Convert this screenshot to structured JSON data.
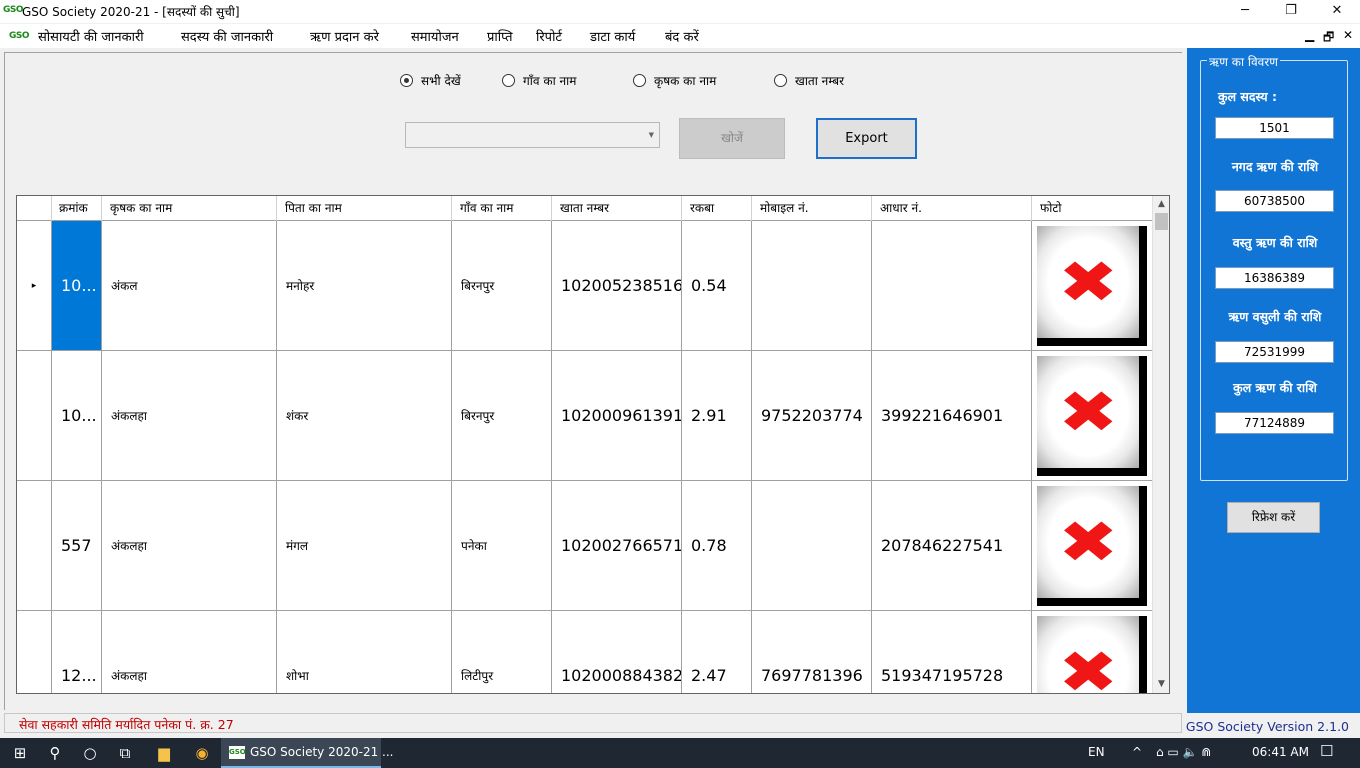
{
  "window": {
    "logo": "GSO",
    "title": "GSO Society 2020-21 - [सदस्यों की सुची]",
    "controls": {
      "minimize": "─",
      "restore": "❐",
      "close": "✕"
    }
  },
  "menu": {
    "logo": "GSO",
    "items": [
      "सोसायटी की जानकारी",
      "सदस्य की जानकारी",
      "ऋण प्रदान करे",
      "समायोजन",
      "प्राप्ति",
      "रिपोर्ट",
      "डाटा कार्य",
      "बंद करें"
    ],
    "mdi": {
      "minimize": "▁",
      "restore": "🗗",
      "close": "✕"
    }
  },
  "filters": {
    "options": [
      "सभी देखें",
      "गाँव का नाम",
      "कृषक का नाम",
      "खाता नम्बर"
    ],
    "selected": "सभी देखें",
    "combo_value": "",
    "search_label": "खोजें",
    "export_label": "Export"
  },
  "grid": {
    "columns": [
      "क्रमांक",
      "कृषक का नाम",
      "पिता का नाम",
      "गाँव का नाम",
      "खाता नम्बर",
      "रकबा",
      "मोबाइल नं.",
      "आधार नं.",
      "फोटो"
    ],
    "rows": [
      {
        "sno": "10...",
        "name": "अंकल",
        "father": "मनोहर",
        "village": "बिरनपुर",
        "account": "102005238516",
        "area": "0.54",
        "mobile": "",
        "aadhar": "",
        "selected": true
      },
      {
        "sno": "10...",
        "name": "अंकलहा",
        "father": "शंकर",
        "village": "बिरनपुर",
        "account": "102000961391",
        "area": "2.91",
        "mobile": "9752203774",
        "aadhar": "399221646901",
        "selected": false
      },
      {
        "sno": "557",
        "name": "अंकलहा",
        "father": "मंगल",
        "village": "पनेका",
        "account": "102002766571",
        "area": "0.78",
        "mobile": "",
        "aadhar": "207846227541",
        "selected": false
      },
      {
        "sno": "12...",
        "name": "अंकलहा",
        "father": "शोभा",
        "village": "लिटीपुर",
        "account": "102000884382",
        "area": "2.47",
        "mobile": "7697781396",
        "aadhar": "519347195728",
        "selected": false
      }
    ],
    "row_marker": "▸",
    "photo_glyph": "✖"
  },
  "summary": {
    "title": "ऋण का विवरण",
    "items": [
      {
        "label": "कुल सदस्य :",
        "value": "1501"
      },
      {
        "label": "नगद ऋण की राशि",
        "value": "60738500"
      },
      {
        "label": "वस्तु ऋण की राशि",
        "value": "16386389"
      },
      {
        "label": "ऋण वसुली की राशि",
        "value": "72531999"
      },
      {
        "label": "कुल ऋण की राशि",
        "value": "77124889"
      }
    ],
    "refresh_label": "रिफ्रेश करें"
  },
  "status": {
    "left": "सेवा सहकारी समिति मर्यादित पनेका पं. क्र. 27",
    "right": "GSO Society Version 2.1.0"
  },
  "taskbar": {
    "app_label": "GSO Society 2020-21 ...",
    "app_logo": "GSO",
    "language": "EN",
    "time": "06:41 AM",
    "icons": {
      "start": "⊞",
      "search": "⚲",
      "cortana": "○",
      "taskview": "⧉",
      "explorer": "▆",
      "chrome": "◉",
      "tray_up": "^",
      "notifications": "☐"
    }
  }
}
